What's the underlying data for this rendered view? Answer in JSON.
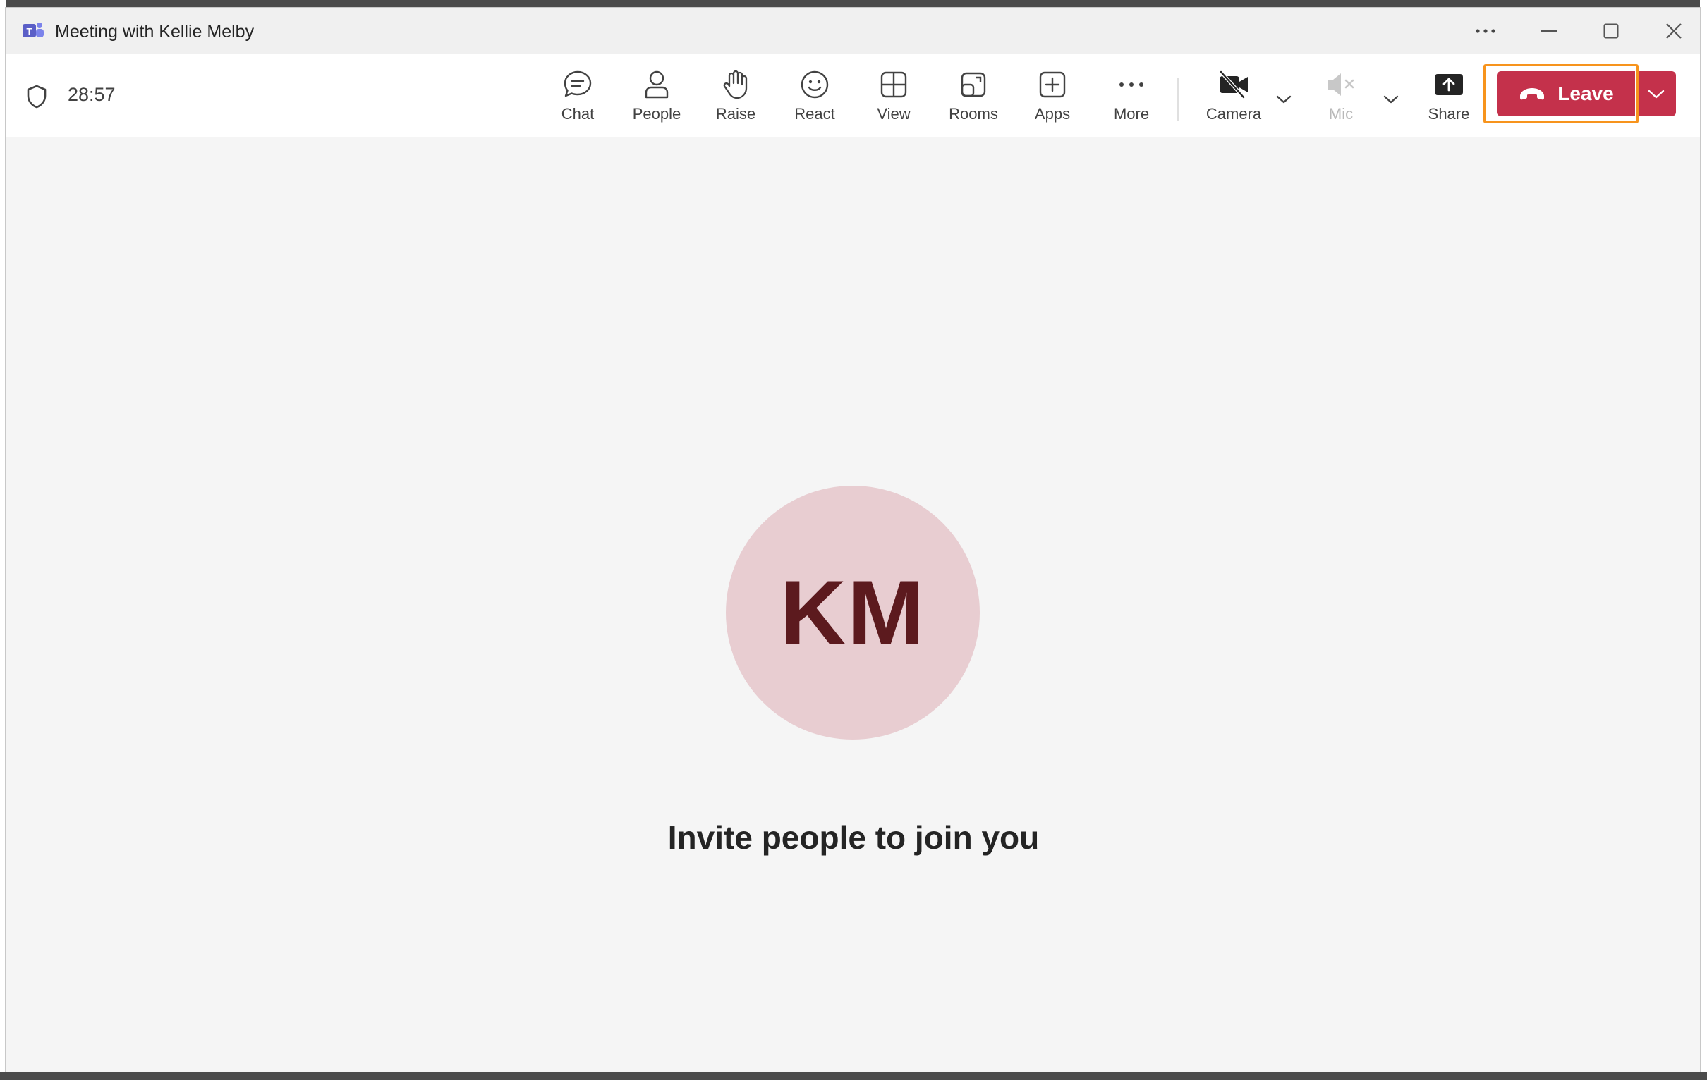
{
  "window": {
    "title": "Meeting with Kellie Melby",
    "app_icon": "teams-icon"
  },
  "meeting": {
    "timer": "28:57"
  },
  "toolbar": {
    "chat_label": "Chat",
    "people_label": "People",
    "raise_label": "Raise",
    "react_label": "React",
    "view_label": "View",
    "rooms_label": "Rooms",
    "apps_label": "Apps",
    "more_label": "More",
    "camera_label": "Camera",
    "mic_label": "Mic",
    "share_label": "Share",
    "leave_label": "Leave"
  },
  "stage": {
    "avatar_initials": "KM",
    "invite_text": "Invite people to join you"
  },
  "colors": {
    "leave_red": "#c4314b",
    "highlight_orange": "#f7941d",
    "avatar_bg": "#e8cdd1",
    "avatar_text": "#5c1a1e",
    "teams_purple": "#5b5fc7"
  }
}
